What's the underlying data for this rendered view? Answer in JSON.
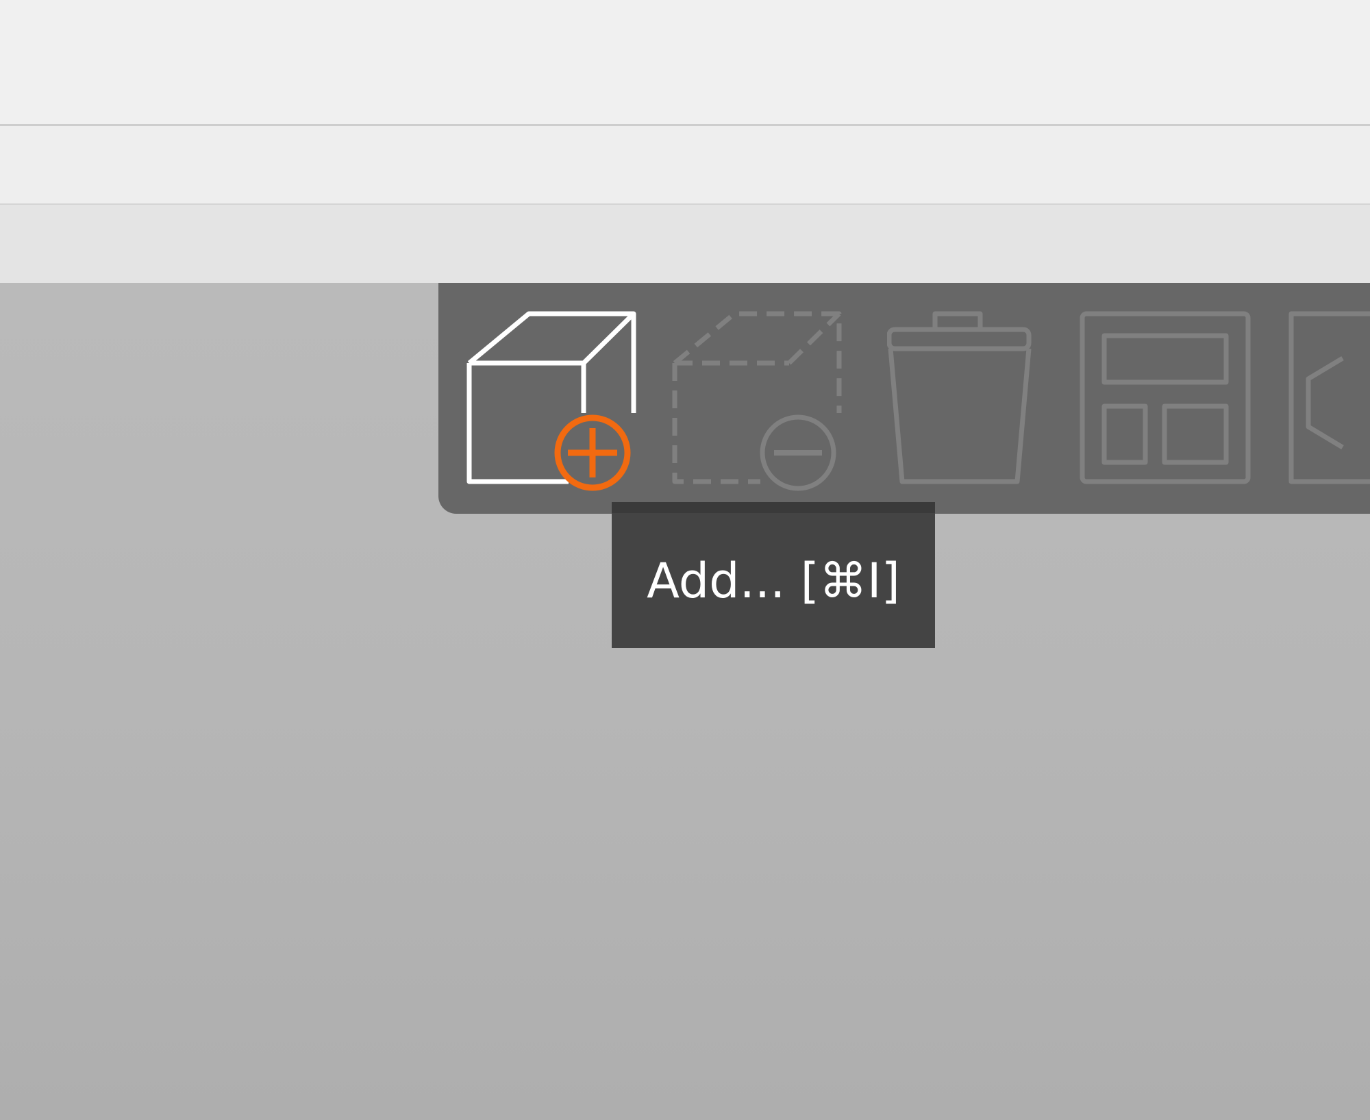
{
  "toolbar": {
    "buttons": [
      {
        "id": "add",
        "icon": "add-object-icon",
        "enabled": true
      },
      {
        "id": "remove",
        "icon": "remove-object-icon",
        "enabled": false
      },
      {
        "id": "delete",
        "icon": "trash-icon",
        "enabled": false
      },
      {
        "id": "arrange",
        "icon": "arrange-layout-icon",
        "enabled": false
      },
      {
        "id": "next",
        "icon": "partial-tool-icon",
        "enabled": false
      }
    ]
  },
  "tooltip": {
    "text": "Add... [⌘I]"
  },
  "colors": {
    "accent": "#f26a10",
    "toolbar_bg": "#676767",
    "icon_enabled": "#ffffff",
    "icon_disabled": "#808080",
    "tooltip_bg": "#444444"
  }
}
